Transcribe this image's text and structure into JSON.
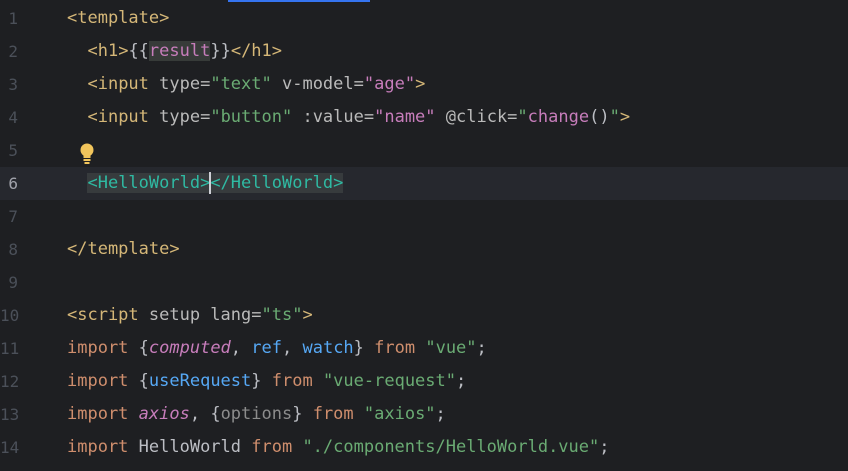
{
  "editor": {
    "lines": [
      {
        "n": "1"
      },
      {
        "n": "2"
      },
      {
        "n": "3"
      },
      {
        "n": "4"
      },
      {
        "n": "5"
      },
      {
        "n": "6"
      },
      {
        "n": "7"
      },
      {
        "n": "8"
      },
      {
        "n": "9"
      },
      {
        "n": "10"
      },
      {
        "n": "11"
      },
      {
        "n": "12"
      },
      {
        "n": "13"
      },
      {
        "n": "14"
      }
    ],
    "tokens": {
      "l1_tag": "<template>",
      "l2_open": "<h1>",
      "l2_lbr": "{{",
      "l2_var": "result",
      "l2_rbr": "}}",
      "l2_close": "</h1>",
      "l3_tag": "<input",
      "l3_attr1": " type=",
      "l3_val1": "\"text\"",
      "l3_attr2": " v-model=",
      "l3_val2": "\"age\"",
      "l3_end": ">",
      "l4_tag": "<input",
      "l4_attr1": " type=",
      "l4_val1": "\"button\"",
      "l4_attr2": " :value=",
      "l4_val2": "\"name\"",
      "l4_attr3": " @click=",
      "l4_q1": "\"",
      "l4_fn": "change",
      "l4_paren": "()",
      "l4_q2": "\"",
      "l4_end": ">",
      "l6_open": "<HelloWorld>",
      "l6_close": "</HelloWorld>",
      "l8_tag": "</template>",
      "l10_tag": "<script",
      "l10_attr": " setup lang=",
      "l10_val": "\"ts\"",
      "l10_end": ">",
      "l11_kw": "import",
      "l11_b1": " {",
      "l11_a": "computed",
      "l11_c1": ", ",
      "l11_b": "ref",
      "l11_c2": ", ",
      "l11_c": "watch",
      "l11_b2": "}",
      "l11_from": " from ",
      "l11_str": "\"vue\"",
      "l11_semi": ";",
      "l12_kw": "import",
      "l12_b1": " {",
      "l12_a": "useRequest",
      "l12_b2": "}",
      "l12_from": " from ",
      "l12_str": "\"vue-request\"",
      "l12_semi": ";",
      "l13_kw": "import",
      "l13_a": " axios",
      "l13_c1": ", {",
      "l13_b": "options",
      "l13_b2": "}",
      "l13_from": " from ",
      "l13_str": "\"axios\"",
      "l13_semi": ";",
      "l14_kw": "import",
      "l14_a": " HelloWorld",
      "l14_from": " from ",
      "l14_str": "\"./components/HelloWorld.vue\"",
      "l14_semi": ";"
    },
    "icons": {
      "intention": "lightbulb-icon"
    }
  }
}
